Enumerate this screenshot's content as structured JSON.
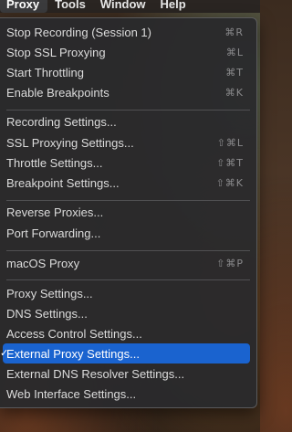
{
  "menubar": {
    "items": [
      "Proxy",
      "Tools",
      "Window",
      "Help"
    ]
  },
  "menu": {
    "groups": [
      {
        "items": [
          {
            "label": "Stop Recording (Session 1)",
            "shortcut": "⌘R"
          },
          {
            "label": "Stop SSL Proxying",
            "shortcut": "⌘L"
          },
          {
            "label": "Start Throttling",
            "shortcut": "⌘T"
          },
          {
            "label": "Enable Breakpoints",
            "shortcut": "⌘K"
          }
        ]
      },
      {
        "items": [
          {
            "label": "Recording Settings...",
            "shortcut": ""
          },
          {
            "label": "SSL Proxying Settings...",
            "shortcut": "⇧⌘L"
          },
          {
            "label": "Throttle Settings...",
            "shortcut": "⇧⌘T"
          },
          {
            "label": "Breakpoint Settings...",
            "shortcut": "⇧⌘K"
          }
        ]
      },
      {
        "items": [
          {
            "label": "Reverse Proxies...",
            "shortcut": ""
          },
          {
            "label": "Port Forwarding...",
            "shortcut": ""
          }
        ]
      },
      {
        "items": [
          {
            "label": "macOS Proxy",
            "shortcut": "⇧⌘P"
          }
        ]
      },
      {
        "items": [
          {
            "label": "Proxy Settings...",
            "shortcut": ""
          },
          {
            "label": "DNS Settings...",
            "shortcut": ""
          },
          {
            "label": "Access Control Settings...",
            "shortcut": ""
          },
          {
            "label": "External Proxy Settings...",
            "shortcut": "",
            "selected": true,
            "checked": true
          },
          {
            "label": "External DNS Resolver Settings...",
            "shortcut": ""
          },
          {
            "label": "Web Interface Settings...",
            "shortcut": ""
          }
        ]
      }
    ]
  },
  "colors": {
    "selection": "#1a63cf",
    "menu_background": "#2a2a2c",
    "text": "#dcdcdc",
    "shortcut_text": "#8a8a8c"
  },
  "icons": {
    "checkmark": "checkmark-icon"
  }
}
